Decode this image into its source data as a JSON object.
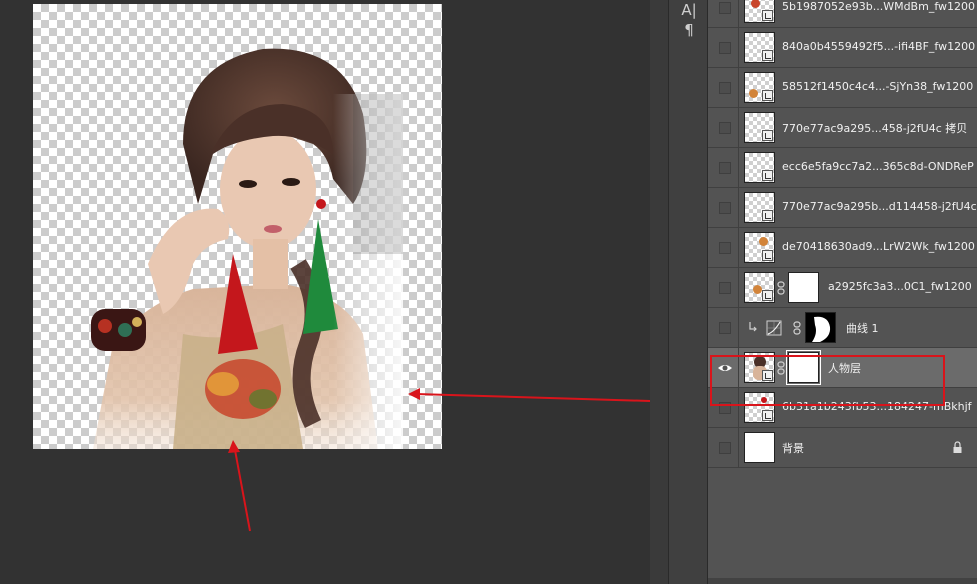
{
  "toolbar": {
    "char_tool_glyph": "A|",
    "paragraph_tool_glyph": "¶"
  },
  "layers": [
    {
      "name": "5b1987052e93b...WMdBm_fw1200",
      "visible": false,
      "smart_object": true
    },
    {
      "name": "840a0b4559492f5...-ifi4BF_fw1200",
      "visible": false,
      "smart_object": true
    },
    {
      "name": "58512f1450c4c4...-SjYn38_fw1200",
      "visible": false,
      "smart_object": true
    },
    {
      "name": "770e77ac9a295...458-j2fU4c 拷贝",
      "visible": false,
      "smart_object": true
    },
    {
      "name": "ecc6e5fa9cc7a2...365c8d-ONDReP",
      "visible": false,
      "smart_object": true
    },
    {
      "name": "770e77ac9a295b...d114458-j2fU4c",
      "visible": false,
      "smart_object": true
    },
    {
      "name": "de70418630ad9...LrW2Wk_fw1200",
      "visible": false,
      "smart_object": true
    },
    {
      "name": "a2925fc3a3...0C1_fw1200",
      "visible": false,
      "smart_object": true,
      "has_mask": true
    },
    {
      "name": "曲线 1",
      "visible": false,
      "adjustment": "curves",
      "clipped": true,
      "has_mask": true
    },
    {
      "name": "人物层",
      "visible": true,
      "selected": true,
      "smart_object": true,
      "has_mask": true
    },
    {
      "name": "6b31a1b243fb53...184247-mBkhjf",
      "visible": false,
      "smart_object": true
    },
    {
      "name": "背景",
      "visible": false,
      "locked": true
    }
  ],
  "colors": {
    "annotation_red": "#d9141b",
    "panel_bg": "#535353",
    "selected_row": "#6b6b6b"
  }
}
